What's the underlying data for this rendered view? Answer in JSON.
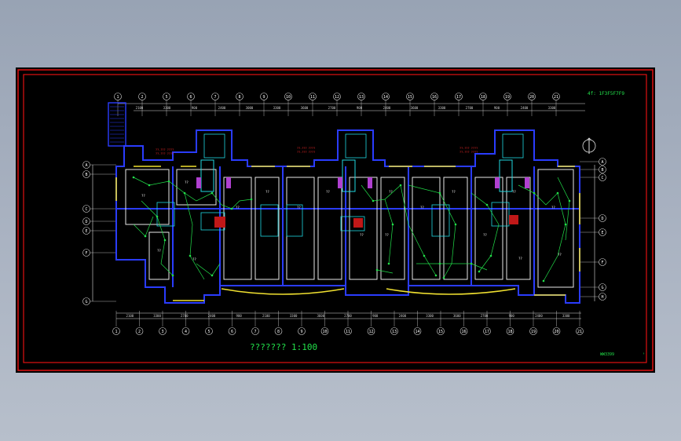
{
  "drawing": {
    "title": "??????? 1:100",
    "top_right_note": "4f: 1F3F5F7F9",
    "bottom_right_note": "WW3399",
    "north_symbol": "N"
  },
  "axes": {
    "top": [
      "1",
      "2",
      "5",
      "6",
      "7",
      "8",
      "9",
      "10",
      "11",
      "12",
      "13",
      "14",
      "15",
      "16",
      "17",
      "18",
      "19",
      "20",
      "21"
    ],
    "bottom": [
      "1",
      "2",
      "3",
      "4",
      "5",
      "6",
      "7",
      "8",
      "9",
      "10",
      "11",
      "12",
      "13",
      "14",
      "15",
      "16",
      "17",
      "18",
      "19",
      "20",
      "21"
    ],
    "left": [
      "A",
      "B",
      "C",
      "D",
      "E",
      "F",
      "G"
    ],
    "right": [
      "A",
      "B",
      "C",
      "D",
      "E",
      "F",
      "G",
      "H"
    ]
  },
  "dimensions": {
    "top": [
      "2100",
      "3300",
      "900",
      "2400",
      "3000",
      "3300",
      "3600",
      "2700",
      "900",
      "2400",
      "3600",
      "3300",
      "2700",
      "900",
      "2400",
      "3300"
    ],
    "bottom": [
      "2100",
      "3300",
      "2700",
      "2400",
      "900",
      "2100",
      "3300",
      "3600",
      "2700",
      "900",
      "2400",
      "3300",
      "3600",
      "2700",
      "900",
      "2400",
      "3300"
    ]
  },
  "rooms": [
    "??",
    "??",
    "??",
    "??",
    "??",
    "??",
    "??",
    "??",
    "??",
    "??",
    "??",
    "??",
    "??",
    "??",
    "??",
    "??",
    "??",
    "??"
  ],
  "red_notes": [
    "??-??? ????",
    "??-??? ????",
    "??-??? ????"
  ]
}
